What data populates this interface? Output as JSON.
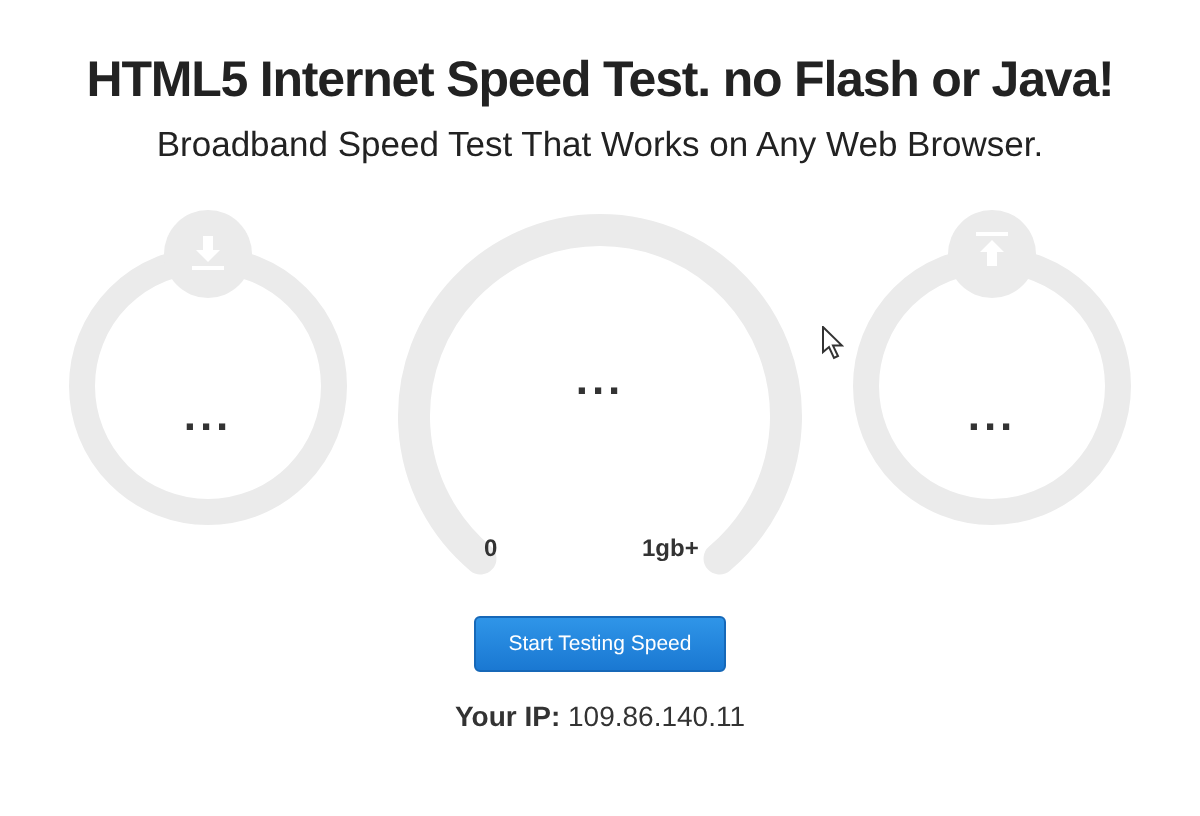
{
  "title": "HTML5 Internet Speed Test. no Flash or Java!",
  "subtitle": "Broadband Speed Test That Works on Any Web Browser.",
  "gauges": [
    {
      "kind": "download",
      "value": "..."
    },
    {
      "kind": "speed",
      "value": "...",
      "min_label": "0",
      "max_label": "1gb+"
    },
    {
      "kind": "upload",
      "value": "..."
    }
  ],
  "button": "Start Testing Speed",
  "ip": {
    "label": "Your IP:",
    "value": "109.86.140.11"
  }
}
